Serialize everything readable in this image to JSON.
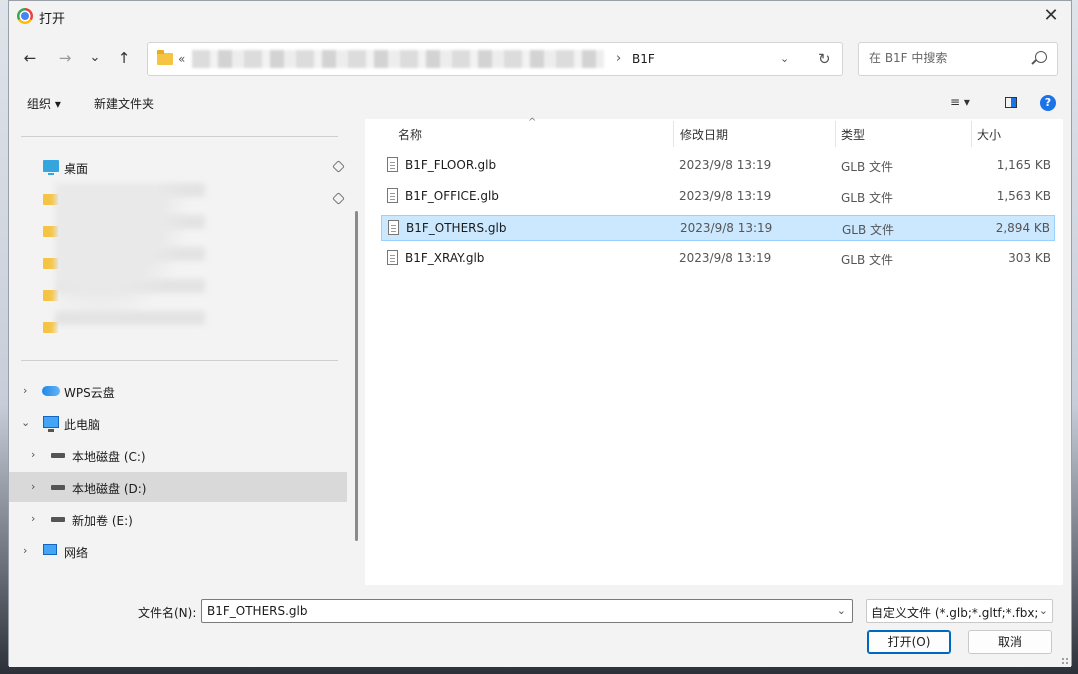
{
  "window": {
    "title": "打开",
    "close_label": "✕"
  },
  "nav": {
    "back": "←",
    "forward": "→",
    "recent": "⌄",
    "up": "↑",
    "address_prefix": "«",
    "separator": "›",
    "current_folder": "B1F",
    "refresh": "↻",
    "search_placeholder": "在 B1F 中搜索"
  },
  "toolbar": {
    "organize": "组织 ▾",
    "new_folder": "新建文件夹",
    "view": "≡ ▾"
  },
  "sidebar": {
    "desktop": "桌面",
    "wps": "WPS云盘",
    "this_pc": "此电脑",
    "drive_c": "本地磁盘 (C:)",
    "drive_d": "本地磁盘 (D:)",
    "drive_e": "新加卷 (E:)",
    "network": "网络",
    "chev_right": "›",
    "chev_down": "⌄"
  },
  "columns": {
    "name": "名称",
    "date": "修改日期",
    "type": "类型",
    "size": "大小",
    "sort": "^"
  },
  "files": [
    {
      "name": "B1F_FLOOR.glb",
      "date": "2023/9/8 13:19",
      "type": "GLB 文件",
      "size": "1,165 KB"
    },
    {
      "name": "B1F_OFFICE.glb",
      "date": "2023/9/8 13:19",
      "type": "GLB 文件",
      "size": "1,563 KB"
    },
    {
      "name": "B1F_OTHERS.glb",
      "date": "2023/9/8 13:19",
      "type": "GLB 文件",
      "size": "2,894 KB"
    },
    {
      "name": "B1F_XRAY.glb",
      "date": "2023/9/8 13:19",
      "type": "GLB 文件",
      "size": "303 KB"
    }
  ],
  "bottom": {
    "filename_label": "文件名(N):",
    "filename_value": "B1F_OTHERS.glb",
    "filetype_value": "自定义文件 (*.glb;*.gltf;*.fbx;*.",
    "dropdown": "⌄",
    "open_button": "打开(O)",
    "cancel_button": "取消"
  },
  "colors": {
    "accent": "#0067c0",
    "selection": "#cce8ff",
    "folder": "#f6c443"
  }
}
